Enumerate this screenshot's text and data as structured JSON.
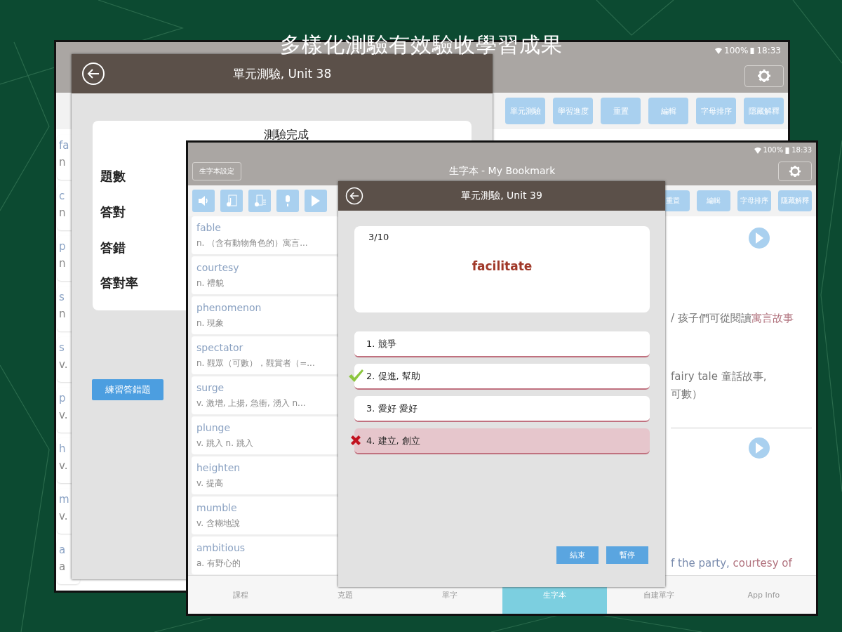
{
  "headline": "多樣化測驗有效驗收學習成果",
  "back_screen": {
    "status_bar": {
      "battery": "100%",
      "time": "18:33"
    },
    "toolbar_buttons": [
      "單元測驗",
      "學習進度",
      "重置",
      "編輯",
      "字母排序",
      "隱藏解釋"
    ],
    "word_list": [
      {
        "word": "fa",
        "definition": "n"
      },
      {
        "word": "c",
        "definition": "n"
      },
      {
        "word": "p",
        "definition": "n"
      },
      {
        "word": "s",
        "definition": "n"
      },
      {
        "word": "s",
        "definition": "v."
      },
      {
        "word": "p",
        "definition": "v."
      },
      {
        "word": "h",
        "definition": "v."
      },
      {
        "word": "m",
        "definition": "v."
      },
      {
        "word": "a",
        "definition": "a"
      }
    ],
    "dialog": {
      "title": "單元測驗, Unit 38",
      "heading": "測驗完成",
      "stats": [
        "題數",
        "答對",
        "答錯",
        "答對率"
      ],
      "button": "練習答錯題"
    }
  },
  "front_screen": {
    "status_bar": {
      "battery": "100%",
      "time": "18:33"
    },
    "settings_button": "生字本設定",
    "title": "生字本 - My Bookmark",
    "toolbar_buttons": [
      "重置",
      "編輯",
      "字母排序",
      "隱藏解釋"
    ],
    "word_list": [
      {
        "word": "fable",
        "definition": "n. （含有動物角色的）寓言..."
      },
      {
        "word": "courtesy",
        "definition": "n. 禮貌"
      },
      {
        "word": "phenomenon",
        "definition": "n. 現象"
      },
      {
        "word": "spectator",
        "definition": "n. 觀眾（可數），觀賞者（=..."
      },
      {
        "word": "surge",
        "definition": "v. 激增, 上揚, 急衝, 湧入  n..."
      },
      {
        "word": "plunge",
        "definition": "v. 跳入  n. 跳入"
      },
      {
        "word": "heighten",
        "definition": "v. 提高"
      },
      {
        "word": "mumble",
        "definition": "v. 含糊地說"
      },
      {
        "word": "ambitious",
        "definition": "a. 有野心的"
      }
    ],
    "entries": [
      {
        "lines": [
          [
            {
              "text": "/ 孩子們可從閱讀",
              "color": "#767676"
            },
            {
              "text": "寓言故事",
              "color": "#b0707c"
            }
          ],
          [
            {
              "text": "fairy tale 童話故事,",
              "color": "#767676"
            }
          ],
          [
            {
              "text": "可數）",
              "color": "#767676"
            }
          ]
        ]
      },
      {
        "lines": [
          [
            {
              "text": "f the party, ",
              "color": "#7a8cae"
            },
            {
              "text": "courtesy of",
              "color": "#b0707c"
            }
          ]
        ]
      }
    ],
    "tabs": [
      {
        "label": "課程",
        "selected": false
      },
      {
        "label": "克題",
        "selected": false
      },
      {
        "label": "單字",
        "selected": false
      },
      {
        "label": "生字本",
        "selected": true
      },
      {
        "label": "自建單字",
        "selected": false
      },
      {
        "label": "App Info",
        "selected": false
      }
    ],
    "dialog": {
      "title": "單元測驗, Unit 39",
      "progress": "3/10",
      "word": "facilitate",
      "options": [
        {
          "label": "1. 競爭",
          "selected": false,
          "correct": false
        },
        {
          "label": "2. 促進, 幫助",
          "selected": false,
          "correct": true
        },
        {
          "label": "3. 愛好  愛好",
          "selected": false,
          "correct": false
        },
        {
          "label": "4. 建立, 創立",
          "selected": true,
          "correct": false
        }
      ],
      "buttons": [
        "結束",
        "暫停"
      ]
    }
  }
}
